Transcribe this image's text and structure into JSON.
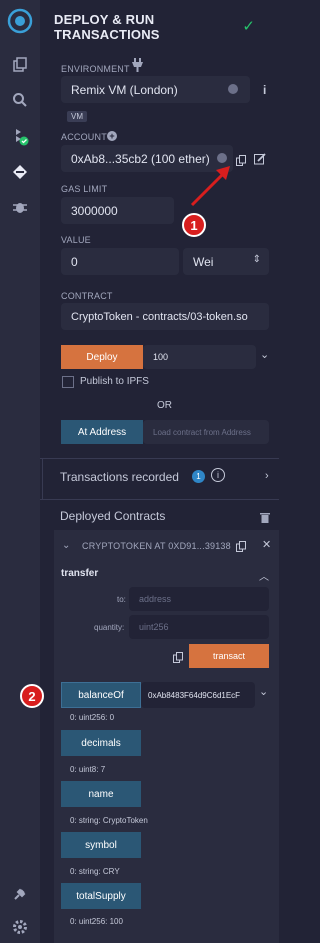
{
  "plugin": {
    "title": "DEPLOY & RUN TRANSACTIONS"
  },
  "environment": {
    "label": "ENVIRONMENT",
    "value": "Remix VM (London)",
    "badge": "VM"
  },
  "account": {
    "label": "ACCOUNT",
    "value": "0xAb8...35cb2 (100 ether)"
  },
  "gas_limit": {
    "label": "GAS LIMIT",
    "value": "3000000"
  },
  "value": {
    "label": "VALUE",
    "amount": "0",
    "unit": "Wei"
  },
  "contract": {
    "label": "CONTRACT",
    "value": "CryptoToken - contracts/03-token.so"
  },
  "deploy": {
    "button": "Deploy",
    "args": "100",
    "publish_label": "Publish to IPFS",
    "or": "OR",
    "at_address_button": "At Address",
    "at_address_placeholder": "Load contract from Address"
  },
  "transactions": {
    "label": "Transactions recorded",
    "count": "1"
  },
  "deployed": {
    "label": "Deployed Contracts",
    "instance_title": "CRYPTOTOKEN AT 0XD91...39138",
    "transfer": {
      "name": "transfer",
      "params": [
        {
          "label": "to:",
          "placeholder": "address"
        },
        {
          "label": "quantity:",
          "placeholder": "uint256"
        }
      ],
      "button": "transact"
    },
    "balanceOf": {
      "name": "balanceOf",
      "arg": "0xAb8483F64d9C6d1EcF",
      "result": "0: uint256: 0"
    },
    "decimals": {
      "name": "decimals",
      "result": "0: uint8: 7"
    },
    "name_fn": {
      "name": "name",
      "result": "0: string: CryptoToken"
    },
    "symbol": {
      "name": "symbol",
      "result": "0: string: CRY"
    },
    "totalSupply": {
      "name": "totalSupply",
      "result": "0: uint256: 100"
    }
  },
  "annotations": {
    "marker1": "1",
    "marker2": "2"
  },
  "colors": {
    "accent_orange": "#d6733f",
    "call_blue": "#2b5775",
    "success_green": "#26c36b",
    "marker_red": "#d81e1e"
  }
}
